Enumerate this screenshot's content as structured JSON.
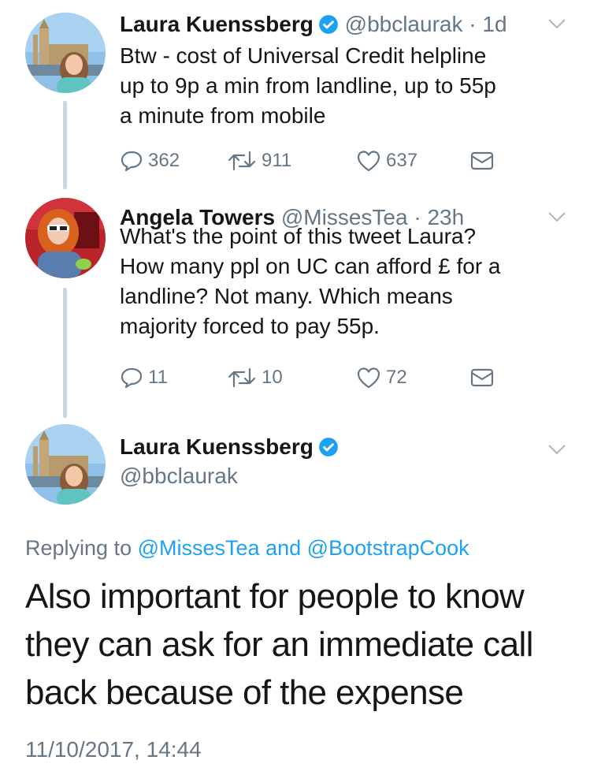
{
  "tweets": [
    {
      "name": "Laura Kuenssberg",
      "handle": "@bbclaurak",
      "separator": "·",
      "time": "1d",
      "lines": [
        "Btw - cost of Universal Credit helpline",
        "up to 9p a min from landline, up to 55p",
        "a minute from mobile"
      ],
      "replies": "362",
      "retweets": "911",
      "likes": "637"
    },
    {
      "name": "Angela Towers",
      "handle": "@MissesTea",
      "separator": "·",
      "time": "23h",
      "lines": [
        "What's the point of this tweet Laura?",
        "How many ppl on UC can afford £ for a",
        "landline? Not many. Which means",
        "majority forced to pay 55p."
      ],
      "replies": "11",
      "retweets": "10",
      "likes": "72"
    }
  ],
  "main": {
    "name": "Laura Kuenssberg",
    "handle": "@bbclaurak",
    "replying_prefix": "Replying to",
    "reply_to_1": "@MissesTea",
    "reply_and": "and",
    "reply_to_2": "@BootstrapCook",
    "lines": [
      "Also important for people to know",
      "they can ask for an immediate call",
      "back because of the expense"
    ],
    "timestamp": "11/10/2017, 14:44"
  },
  "colors": {
    "accent": "#1da1f2",
    "muted": "#657786",
    "text": "#14171a",
    "thread_line": "#ccd6dd"
  },
  "icons": [
    "verified-badge-icon",
    "chevron-down-icon",
    "reply-icon",
    "retweet-icon",
    "like-icon",
    "direct-message-icon"
  ]
}
